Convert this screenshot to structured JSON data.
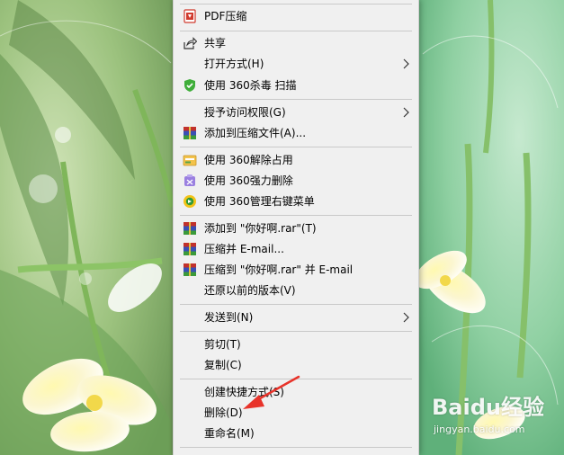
{
  "context_menu": {
    "items": {
      "pdf_compress": "PDF压缩",
      "share": "共享",
      "open_with": "打开方式(H)",
      "scan_360": "使用 360杀毒 扫描",
      "grant_access": "授予访问权限(G)",
      "add_to_archive": "添加到压缩文件(A)...",
      "unlock_360": "使用 360解除占用",
      "force_delete_360": "使用 360强力删除",
      "manage_menu_360": "使用 360管理右键菜单",
      "add_to_rar": "添加到 \"你好啊.rar\"(T)",
      "compress_email": "压缩并 E-mail...",
      "compress_rar_email": "压缩到 \"你好啊.rar\" 并 E-mail",
      "restore_previous": "还原以前的版本(V)",
      "send_to": "发送到(N)",
      "cut": "剪切(T)",
      "copy": "复制(C)",
      "create_shortcut": "创建快捷方式(S)",
      "delete": "删除(D)",
      "rename": "重命名(M)"
    },
    "icons": {
      "pdf_compress": "pdf-compress-icon",
      "share": "share-icon",
      "scan_360": "shield-icon",
      "add_to_archive": "winrar-icon",
      "unlock_360": "unlock-icon",
      "force_delete_360": "force-delete-icon",
      "manage_menu_360": "menu-manager-icon",
      "add_to_rar": "winrar-icon",
      "compress_email": "winrar-icon",
      "compress_rar_email": "winrar-icon",
      "submenu_arrow": "chevron-right-icon"
    },
    "background_color": "#f0f0f0",
    "separator_color": "#c9c9c9"
  },
  "annotation": {
    "arrow_color": "#e8332a"
  },
  "watermark": {
    "logo": "Baidu经验",
    "url": "jingyan.baidu.com"
  }
}
